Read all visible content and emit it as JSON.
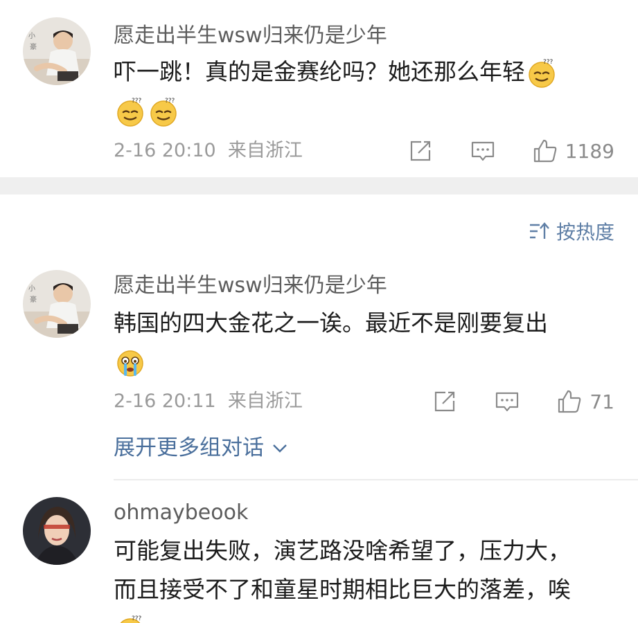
{
  "comments": [
    {
      "username": "愿走出半生wsw归来仍是少年",
      "text": "吓一跳！真的是金赛纶吗？她还那么年轻",
      "emoji": [
        "dizzy-face-emoji",
        "dizzy-face-emoji",
        "dizzy-face-emoji"
      ],
      "date": "2-16 20:10",
      "location": "来自浙江",
      "likes": "1189"
    },
    {
      "username": "愿走出半生wsw归来仍是少年",
      "text": "韩国的四大金花之一诶。最近不是刚要复出",
      "emoji": [
        "crying-face-emoji"
      ],
      "date": "2-16 20:11",
      "location": "来自浙江",
      "likes": "71"
    },
    {
      "username": "ohmaybeook",
      "text_line1": "可能复出失败，演艺路没啥希望了，压力大，",
      "text_line2": "而且接受不了和童星时期相比巨大的落差，唉",
      "emoji": [
        "dizzy-face-emoji"
      ]
    }
  ],
  "sort": {
    "label": "按热度",
    "icon": "sort-icon"
  },
  "expand": {
    "label": "展开更多组对话",
    "icon": "chevron-down-icon"
  },
  "icons": {
    "share": "share-icon",
    "comment": "comment-icon",
    "like": "thumbs-up-icon"
  },
  "colors": {
    "link": "#4a6f9c",
    "meta": "#9a9a9a",
    "username": "#5c5c5c",
    "divider": "#efefef"
  }
}
